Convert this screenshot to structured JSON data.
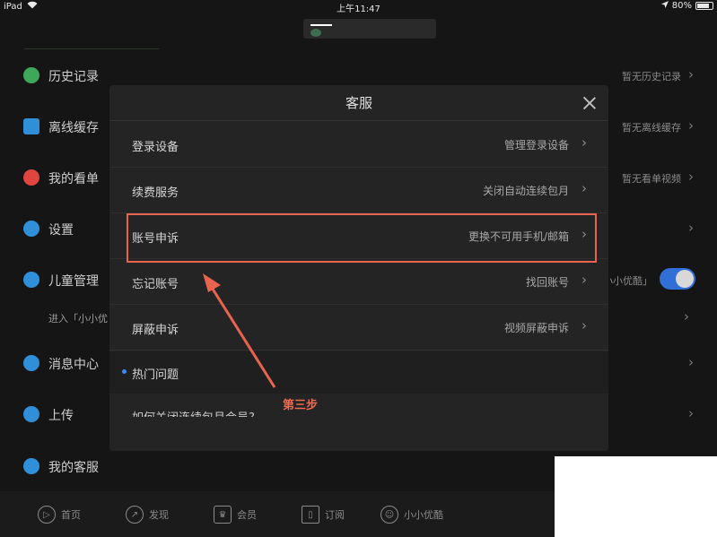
{
  "status_bar": {
    "device": "iPad",
    "time": "上午11:47",
    "battery": "80%",
    "battery_level": 0.8
  },
  "menu": {
    "items": [
      {
        "label": "历史记录",
        "hint": "暂无历史记录",
        "icon": "history-icon",
        "color": "#3da85a"
      },
      {
        "label": "离线缓存",
        "hint": "暂无离线缓存",
        "icon": "download-icon",
        "color": "#2f8fd8"
      },
      {
        "label": "我的看单",
        "hint": "暂无看单视频",
        "icon": "heart-icon",
        "color": "#e0463f"
      },
      {
        "label": "设置",
        "hint": "",
        "icon": "gear-icon",
        "color": "#2f8fd8"
      },
      {
        "label": "儿童管理",
        "hint": "小小优酷」",
        "icon": "kid-face-icon",
        "color": "#2f8fd8"
      },
      {
        "label": "消息中心",
        "hint": "",
        "icon": "chat-icon",
        "color": "#2f8fd8"
      },
      {
        "label": "上传",
        "hint": "",
        "icon": "cloud-upload-icon",
        "color": "#2f8fd8"
      },
      {
        "label": "我的客服",
        "hint": "",
        "icon": "phone-icon",
        "color": "#2f8fd8"
      }
    ],
    "kids_sub": "进入「小小优"
  },
  "tabbar": {
    "tabs": [
      {
        "label": "首页",
        "icon": "home-play-icon"
      },
      {
        "label": "发现",
        "icon": "compass-icon"
      },
      {
        "label": "会员",
        "icon": "crown-icon"
      },
      {
        "label": "订阅",
        "icon": "bookmark-icon"
      },
      {
        "label": "小小优酷",
        "icon": "kid-face-icon"
      }
    ]
  },
  "modal": {
    "title": "客服",
    "rows": [
      {
        "label": "登录设备",
        "value": "管理登录设备"
      },
      {
        "label": "续费服务",
        "value": "关闭自动连续包月"
      },
      {
        "label": "账号申诉",
        "value": "更换不可用手机/邮箱"
      },
      {
        "label": "忘记账号",
        "value": "找回账号"
      },
      {
        "label": "屏蔽申诉",
        "value": "视频屏蔽申诉"
      }
    ],
    "section_title": "热门问题",
    "partial_row": "如何关闭连续包月会员?"
  },
  "annotation": {
    "step_label": "第三步",
    "color": "#e8644f"
  }
}
